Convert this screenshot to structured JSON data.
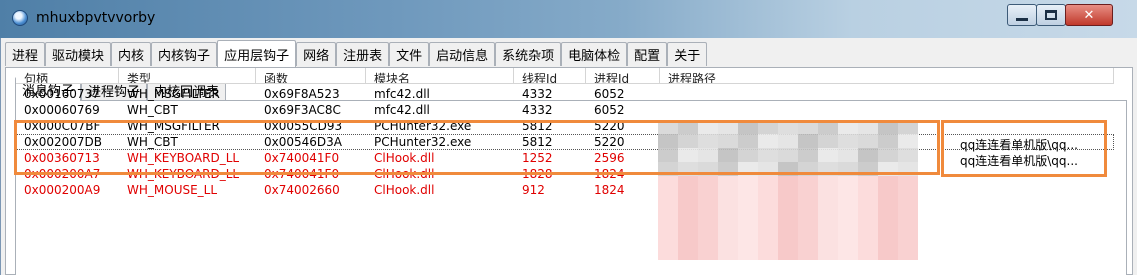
{
  "window": {
    "title": "mhuxbpvtvvorby"
  },
  "main_tabs": [
    "进程",
    "驱动模块",
    "内核",
    "内核钩子",
    "应用层钩子",
    "网络",
    "注册表",
    "文件",
    "启动信息",
    "系统杂项",
    "电脑体检",
    "配置",
    "关于"
  ],
  "active_main_tab": "应用层钩子",
  "sub_tabs": [
    "消息钩子",
    "进程钩子",
    "内核回调表"
  ],
  "active_sub_tab": "消息钩子",
  "table": {
    "columns": [
      "句柄",
      "类型",
      "函数",
      "模块名",
      "线程Id",
      "进程Id",
      "进程路径"
    ],
    "rows": [
      {
        "handle": "0x00160737",
        "type": "WH_MSGFILTER",
        "func": "0x69F8A523",
        "module": "mfc42.dll",
        "tid": "4332",
        "pid": "6052",
        "path": "qq连连看单机版\\qq...",
        "color": "black"
      },
      {
        "handle": "0x00060769",
        "type": "WH_CBT",
        "func": "0x69F3AC8C",
        "module": "mfc42.dll",
        "tid": "4332",
        "pid": "6052",
        "path": "qq连连看单机版\\qq...",
        "color": "black"
      },
      {
        "handle": "0x000C07BF",
        "type": "WH_MSGFILTER",
        "func": "0x0055CD93",
        "module": "PCHunter32.exe",
        "tid": "5812",
        "pid": "5220",
        "path": "",
        "color": "black"
      },
      {
        "handle": "0x002007DB",
        "type": "WH_CBT",
        "func": "0x00546D3A",
        "module": "PCHunter32.exe",
        "tid": "5812",
        "pid": "5220",
        "path": "",
        "color": "black"
      },
      {
        "handle": "0x00360713",
        "type": "WH_KEYBOARD_LL",
        "func": "0x740041F0",
        "module": "ClHook.dll",
        "tid": "1252",
        "pid": "2596",
        "path": "",
        "color": "red"
      },
      {
        "handle": "0x000200A7",
        "type": "WH_KEYBOARD_LL",
        "func": "0x740041F0",
        "module": "ClHook.dll",
        "tid": "1828",
        "pid": "1824",
        "path": "",
        "color": "red"
      },
      {
        "handle": "0x000200A9",
        "type": "WH_MOUSE_LL",
        "func": "0x74002660",
        "module": "ClHook.dll",
        "tid": "912",
        "pid": "1824",
        "path": "",
        "color": "red"
      }
    ]
  },
  "colors": {
    "highlight": "#f08a3c",
    "red_text": "#e00000"
  }
}
